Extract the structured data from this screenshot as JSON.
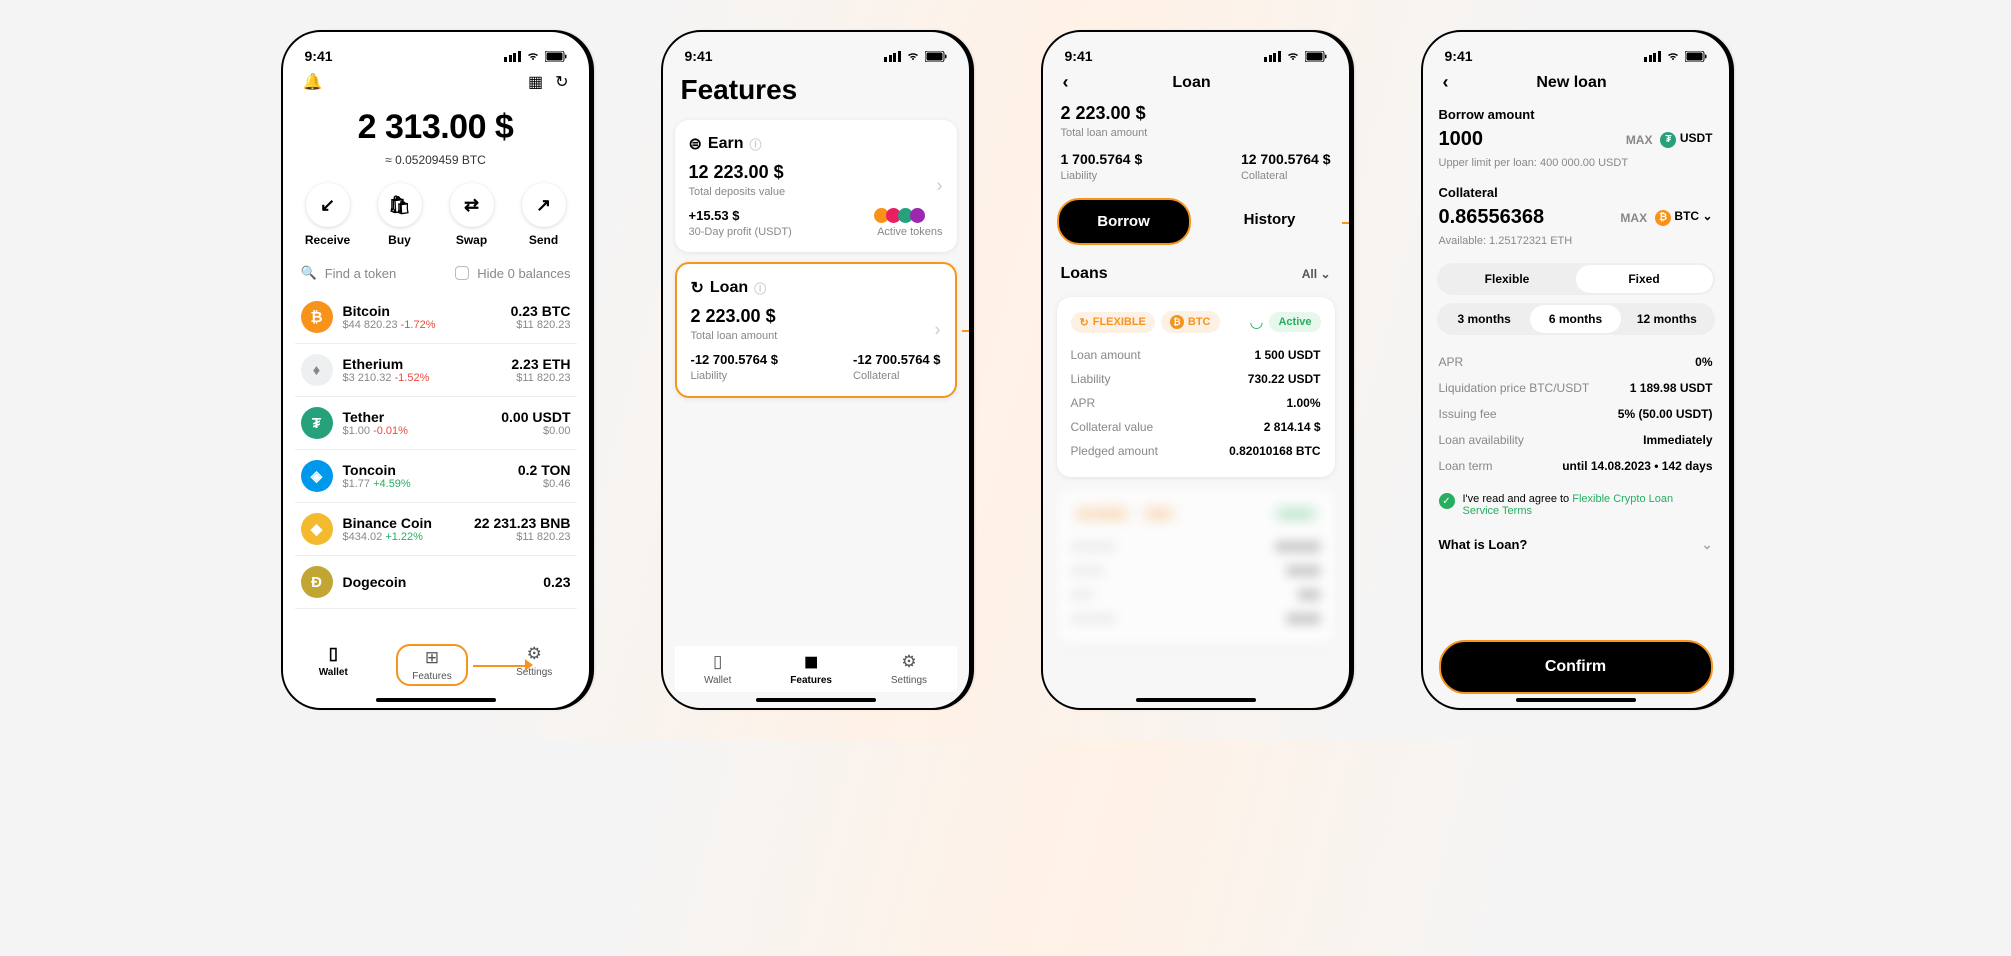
{
  "status": {
    "time": "9:41"
  },
  "screen1": {
    "balance_main": "2 313.00 $",
    "balance_sub": "≈ 0.05209459 BTC",
    "actions": {
      "receive": "Receive",
      "buy": "Buy",
      "swap": "Swap",
      "send": "Send"
    },
    "search_placeholder": "Find a token",
    "hide_zero": "Hide 0 balances",
    "tokens": [
      {
        "name": "Bitcoin",
        "sub": "$44 820.23",
        "chg": "-1.72%",
        "chgdir": "neg",
        "amt": "0.23 BTC",
        "val": "$11 820.23",
        "color": "#f7931a",
        "sym": "₿"
      },
      {
        "name": "Etherium",
        "sub": "$3 210.32",
        "chg": "-1.52%",
        "chgdir": "neg",
        "amt": "2.23 ETH",
        "val": "$11 820.23",
        "color": "#ecf0f1",
        "sym": "♦"
      },
      {
        "name": "Tether",
        "sub": "$1.00",
        "chg": "-0.01%",
        "chgdir": "neg",
        "amt": "0.00 USDT",
        "val": "$0.00",
        "color": "#26a17b",
        "sym": "₮"
      },
      {
        "name": "Toncoin",
        "sub": "$1.77",
        "chg": "+4.59%",
        "chgdir": "pos",
        "amt": "0.2 TON",
        "val": "$0.46",
        "color": "#0098ea",
        "sym": "◈"
      },
      {
        "name": "Binance Coin",
        "sub": "$434.02",
        "chg": "+1.22%",
        "chgdir": "pos",
        "amt": "22 231.23 BNB",
        "val": "$11 820.23",
        "color": "#f3ba2f",
        "sym": "◆"
      },
      {
        "name": "Dogecoin",
        "sub": "",
        "chg": "",
        "chgdir": "",
        "amt": "0.23",
        "val": "",
        "color": "#c2a633",
        "sym": "Ð"
      }
    ],
    "tabs": {
      "wallet": "Wallet",
      "features": "Features",
      "settings": "Settings"
    }
  },
  "screen2": {
    "title": "Features",
    "earn": {
      "title": "Earn",
      "value": "12 223.00 $",
      "sub": "Total deposits value",
      "profit": "+15.53 $",
      "profit_label": "30-Day profit (USDT)",
      "active_label": "Active tokens"
    },
    "loan": {
      "title": "Loan",
      "value": "2 223.00 $",
      "sub": "Total loan amount",
      "liab_v": "-12 700.5764 $",
      "liab_l": "Liability",
      "coll_v": "-12 700.5764 $",
      "coll_l": "Collateral"
    },
    "tabs": {
      "wallet": "Wallet",
      "features": "Features",
      "settings": "Settings"
    }
  },
  "screen3": {
    "title": "Loan",
    "total_v": "2 223.00 $",
    "total_l": "Total loan amount",
    "liab_v": "1 700.5764 $",
    "liab_l": "Liability",
    "coll_v": "12 700.5764 $",
    "coll_l": "Collateral",
    "borrow": "Borrow",
    "history": "History",
    "loans_title": "Loans",
    "filter": "All",
    "flex_pill": "FLEXIBLE",
    "btc_pill": "BTC",
    "active_pill": "Active",
    "rows": [
      {
        "k": "Loan amount",
        "v": "1 500 USDT"
      },
      {
        "k": "Liability",
        "v": "730.22 USDT"
      },
      {
        "k": "APR",
        "v": "1.00%"
      },
      {
        "k": "Collateral value",
        "v": "2 814.14 $"
      },
      {
        "k": "Pledged amount",
        "v": "0.82010168 BTC"
      }
    ]
  },
  "screen4": {
    "title": "New loan",
    "borrow_lbl": "Borrow amount",
    "borrow_v": "1000",
    "borrow_max": "MAX",
    "borrow_cur": "USDT",
    "borrow_note": "Upper limit per loan: 400 000.00 USDT",
    "coll_lbl": "Collateral",
    "coll_v": "0.86556368",
    "coll_max": "MAX",
    "coll_cur": "BTC",
    "coll_note": "Available: 1.25172321 ETH",
    "seg1": {
      "flex": "Flexible",
      "fixed": "Fixed"
    },
    "seg2": {
      "m3": "3 months",
      "m6": "6 months",
      "m12": "12 months"
    },
    "rows": [
      {
        "k": "APR",
        "v": "0%"
      },
      {
        "k": "Liquidation price BTC/USDT",
        "v": "1 189.98 USDT"
      },
      {
        "k": "Issuing fee",
        "v": "5% (50.00 USDT)"
      },
      {
        "k": "Loan availability",
        "v": "Immediately"
      },
      {
        "k": "Loan term",
        "v": "until 14.08.2023 • 142 days"
      }
    ],
    "agree_prefix": "I've read and agree to ",
    "agree_link": "Flexible Crypto Loan Service Terms",
    "what_is": "What is Loan?",
    "confirm": "Confirm"
  }
}
